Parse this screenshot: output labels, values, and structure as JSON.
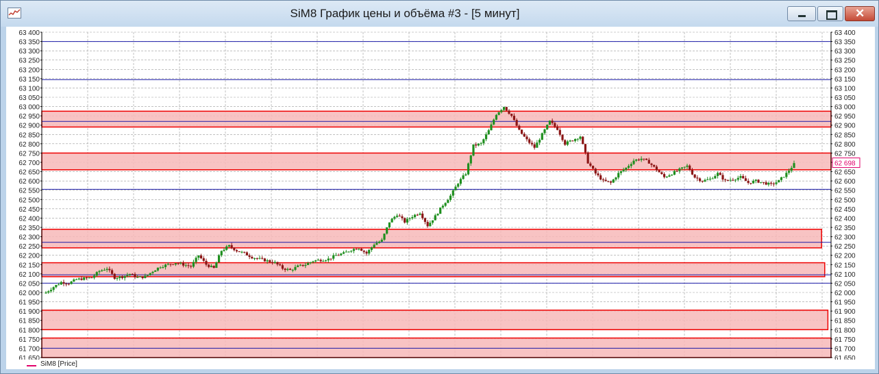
{
  "window": {
    "title": "SiM8 График цены и объёма #3 - [5 минут]",
    "buttons": [
      "minimize",
      "maximize",
      "close"
    ]
  },
  "legend": {
    "label": "SiM8 [Price]",
    "color": "#e0006a"
  },
  "colors": {
    "bull": "#1f8f1f",
    "bear": "#8b1616",
    "zone_fill": "#f7b9b9",
    "zone_border": "#ee0000",
    "level_line": "#1a1aa8",
    "grid": "#9a9a9a",
    "price_tag": "#e0006a"
  },
  "chart_data": {
    "type": "candlestick",
    "ylim": [
      61650,
      63400
    ],
    "yticks": [
      63400,
      63350,
      63300,
      63250,
      63200,
      63150,
      63100,
      63050,
      63000,
      62950,
      62900,
      62850,
      62800,
      62750,
      62700,
      62650,
      62600,
      62550,
      62500,
      62450,
      62400,
      62350,
      62300,
      62250,
      62200,
      62150,
      62100,
      62050,
      62000,
      61950,
      61900,
      61850,
      61800,
      61750,
      61700,
      61650
    ],
    "ytick_labels": [
      "63 400",
      "63 350",
      "63 300",
      "63 250",
      "63 200",
      "63 150",
      "63 100",
      "63 050",
      "63 000",
      "62 950",
      "62 900",
      "62 850",
      "62 800",
      "62 750",
      "62 700",
      "62 650",
      "62 600",
      "62 550",
      "62 500",
      "62 450",
      "62 400",
      "62 350",
      "62 300",
      "62 250",
      "62 200",
      "62 150",
      "62 100",
      "62 050",
      "62 000",
      "61 950",
      "61 900",
      "61 850",
      "61 800",
      "61 750",
      "61 700",
      "61 650"
    ],
    "last_price": "62 698",
    "horizontal_levels": [
      63350,
      63145,
      62920,
      62555,
      62270,
      62095,
      62050,
      61700
    ],
    "zones": [
      {
        "top": 62975,
        "bottom": 62890,
        "end": 1.0
      },
      {
        "top": 62750,
        "bottom": 62660,
        "end": 1.0
      },
      {
        "top": 62340,
        "bottom": 62240,
        "end": 0.988
      },
      {
        "top": 62160,
        "bottom": 62085,
        "end": 0.992
      },
      {
        "top": 61905,
        "bottom": 61800,
        "end": 0.996
      },
      {
        "top": 61755,
        "bottom": 61650,
        "end": 1.0
      }
    ],
    "price_path": [
      [
        0,
        62000
      ],
      [
        3,
        62030
      ],
      [
        6,
        62055
      ],
      [
        9,
        62050
      ],
      [
        12,
        62070
      ],
      [
        15,
        62075
      ],
      [
        18,
        62080
      ],
      [
        21,
        62115
      ],
      [
        24,
        62130
      ],
      [
        27,
        62080
      ],
      [
        30,
        62085
      ],
      [
        33,
        62100
      ],
      [
        36,
        62080
      ],
      [
        39,
        62085
      ],
      [
        42,
        62115
      ],
      [
        45,
        62140
      ],
      [
        48,
        62150
      ],
      [
        51,
        62160
      ],
      [
        54,
        62150
      ],
      [
        57,
        62140
      ],
      [
        60,
        62200
      ],
      [
        63,
        62150
      ],
      [
        66,
        62130
      ],
      [
        69,
        62225
      ],
      [
        72,
        62250
      ],
      [
        75,
        62225
      ],
      [
        78,
        62210
      ],
      [
        81,
        62190
      ],
      [
        84,
        62180
      ],
      [
        87,
        62170
      ],
      [
        90,
        62160
      ],
      [
        93,
        62130
      ],
      [
        96,
        62120
      ],
      [
        99,
        62140
      ],
      [
        102,
        62150
      ],
      [
        105,
        62170
      ],
      [
        108,
        62175
      ],
      [
        111,
        62180
      ],
      [
        114,
        62200
      ],
      [
        117,
        62210
      ],
      [
        120,
        62230
      ],
      [
        123,
        62240
      ],
      [
        126,
        62210
      ],
      [
        129,
        62260
      ],
      [
        132,
        62280
      ],
      [
        135,
        62380
      ],
      [
        138,
        62420
      ],
      [
        141,
        62380
      ],
      [
        144,
        62410
      ],
      [
        147,
        62430
      ],
      [
        150,
        62360
      ],
      [
        153,
        62410
      ],
      [
        156,
        62470
      ],
      [
        159,
        62520
      ],
      [
        162,
        62590
      ],
      [
        165,
        62640
      ],
      [
        168,
        62790
      ],
      [
        171,
        62800
      ],
      [
        174,
        62870
      ],
      [
        177,
        62960
      ],
      [
        180,
        63000
      ],
      [
        183,
        62950
      ],
      [
        186,
        62870
      ],
      [
        189,
        62820
      ],
      [
        192,
        62780
      ],
      [
        195,
        62850
      ],
      [
        198,
        62920
      ],
      [
        201,
        62880
      ],
      [
        204,
        62800
      ],
      [
        207,
        62820
      ],
      [
        210,
        62840
      ],
      [
        213,
        62700
      ],
      [
        216,
        62640
      ],
      [
        219,
        62600
      ],
      [
        222,
        62590
      ],
      [
        225,
        62640
      ],
      [
        228,
        62670
      ],
      [
        231,
        62710
      ],
      [
        234,
        62720
      ],
      [
        237,
        62700
      ],
      [
        240,
        62660
      ],
      [
        243,
        62620
      ],
      [
        246,
        62640
      ],
      [
        249,
        62660
      ],
      [
        252,
        62680
      ],
      [
        255,
        62620
      ],
      [
        258,
        62600
      ],
      [
        261,
        62610
      ],
      [
        264,
        62640
      ],
      [
        267,
        62600
      ],
      [
        270,
        62610
      ],
      [
        273,
        62620
      ],
      [
        276,
        62590
      ],
      [
        279,
        62600
      ],
      [
        282,
        62590
      ],
      [
        285,
        62580
      ],
      [
        288,
        62600
      ],
      [
        291,
        62640
      ],
      [
        294,
        62690
      ]
    ]
  }
}
